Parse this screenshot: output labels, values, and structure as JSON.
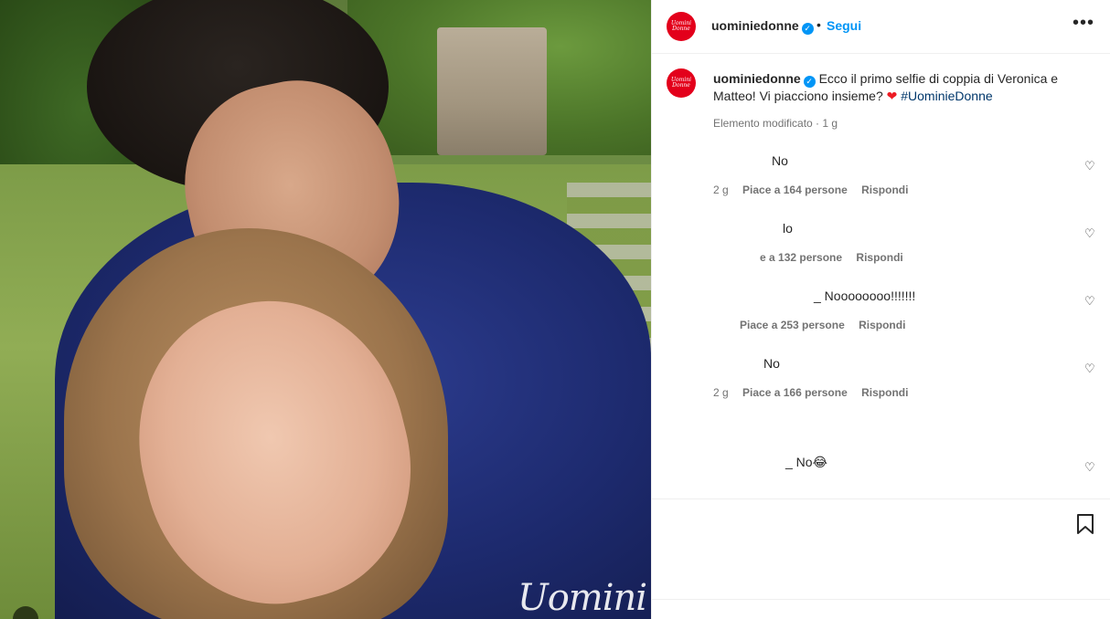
{
  "post": {
    "account": "uominiedonne",
    "follow_label": "Segui",
    "separator": "•",
    "more_label": "•••",
    "avatar_text": "Uomini Donne",
    "watermark": "Uomini"
  },
  "caption": {
    "account": "uominiedonne",
    "text": "Ecco il primo selfie di coppia di Veronica e Matteo! Vi piacciono insieme?",
    "heart": "❤",
    "hashtag": "#UominieDonne",
    "meta": "Elemento modificato · 1 g"
  },
  "comments": [
    {
      "text": "No",
      "age": "2 g",
      "likes": "Piace a 164 persone",
      "reply": "Rispondi"
    },
    {
      "text": "lo",
      "age": "",
      "likes": "e a 132 persone",
      "reply": "Rispondi"
    },
    {
      "text": "_ Noooooooo!!!!!!!",
      "age": "",
      "likes": "Piace a 253 persone",
      "reply": "Rispondi"
    },
    {
      "text": "No",
      "age": "2 g",
      "likes": "Piace a 166 persone",
      "reply": "Rispondi"
    },
    {
      "text": "_ No😂",
      "age": "",
      "likes": "",
      "reply": ""
    }
  ],
  "icons": {
    "like": "heart-outline-icon",
    "save": "bookmark-icon",
    "verified": "verified-badge-icon",
    "more": "more-options-icon"
  },
  "colors": {
    "accent": "#0095f6",
    "brand": "#e3001b",
    "hashtag": "#00376b",
    "muted": "#737373"
  }
}
